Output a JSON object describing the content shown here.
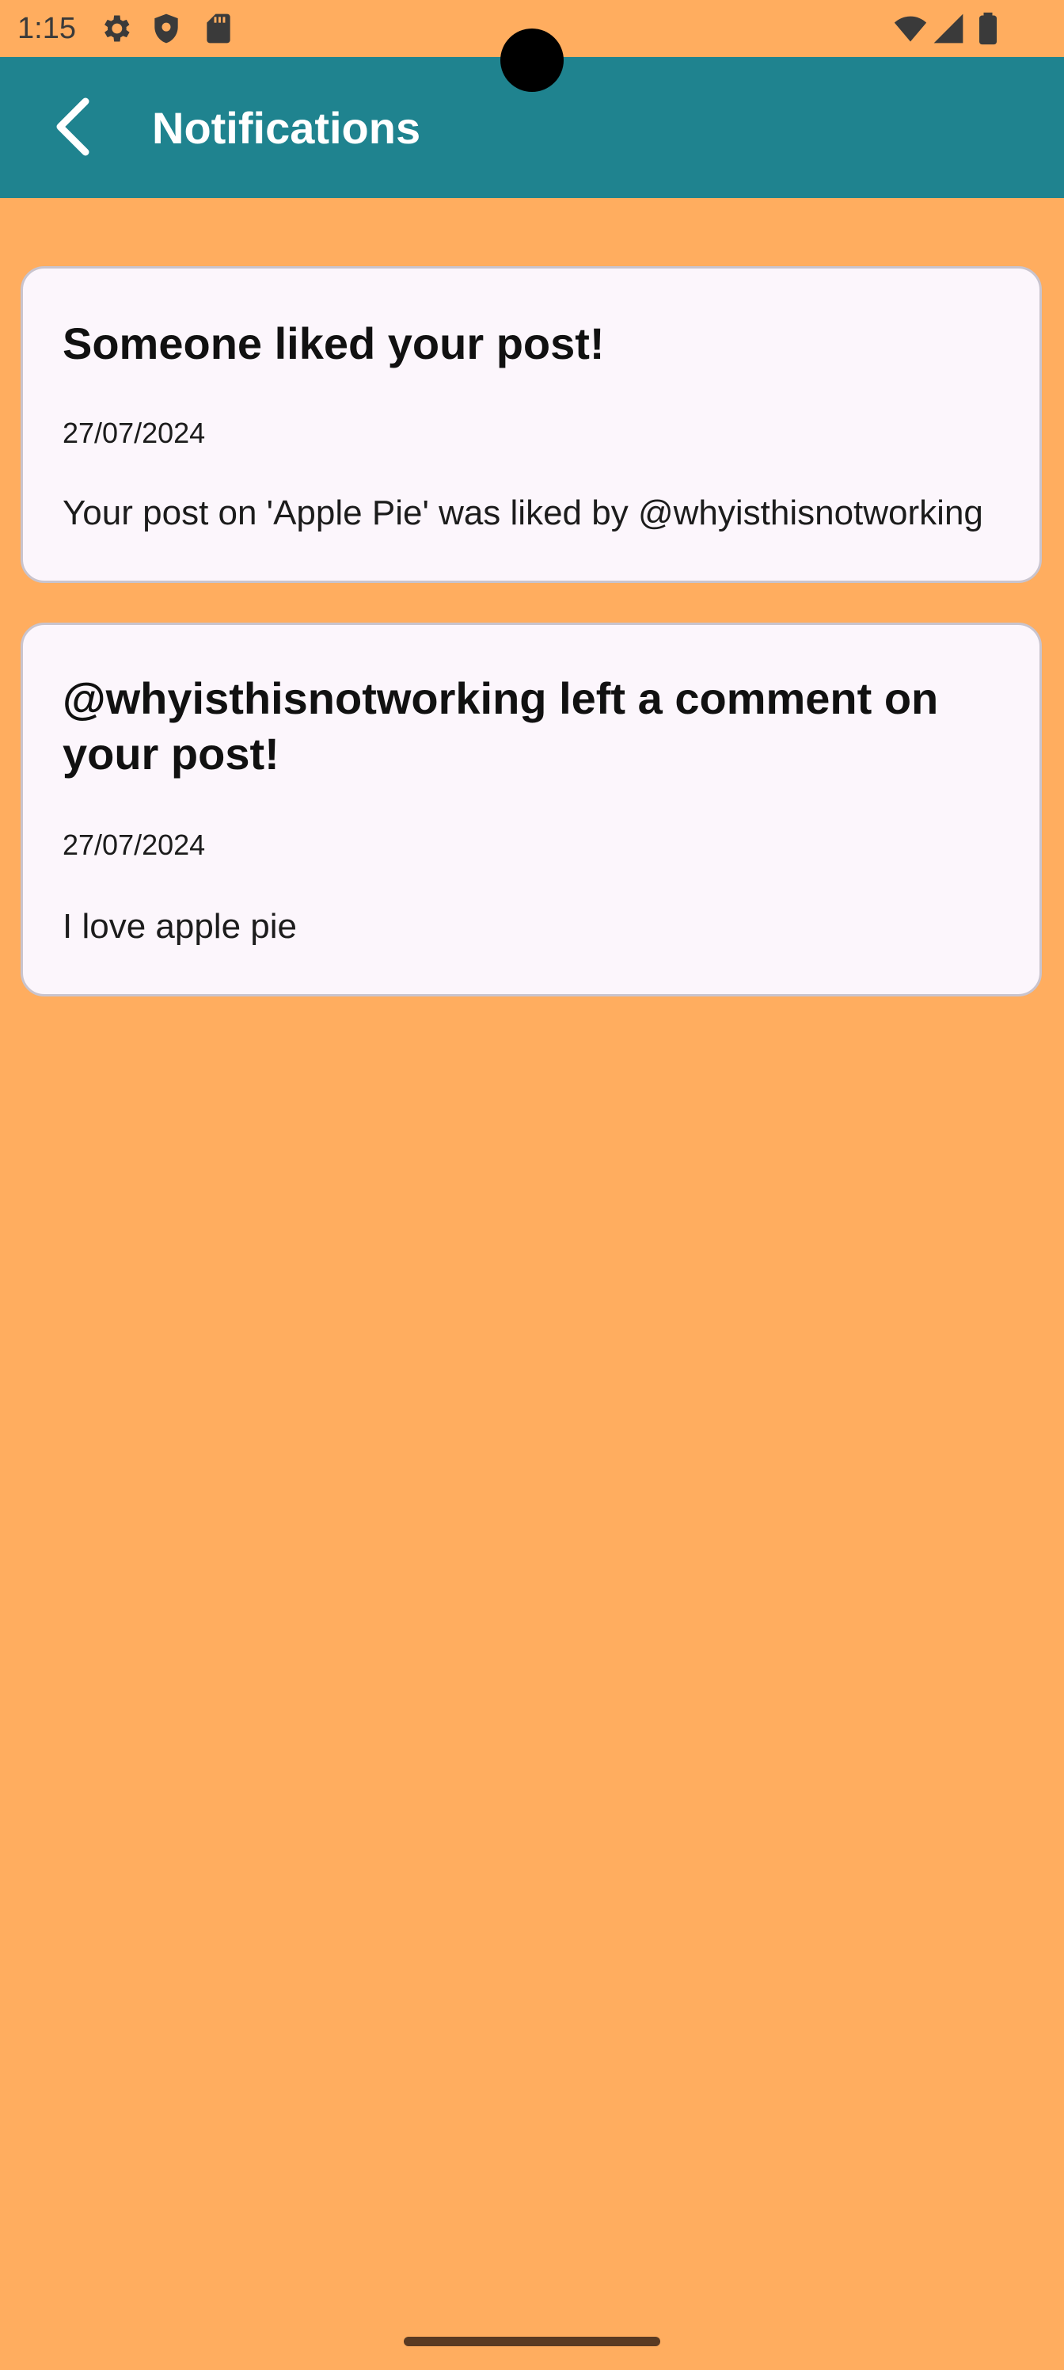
{
  "status_bar": {
    "time": "1:15",
    "icons_left": [
      "gear-icon",
      "shield-icon",
      "sd-card-icon"
    ],
    "icons_right": [
      "wifi-icon",
      "signal-icon",
      "battery-icon"
    ]
  },
  "toolbar": {
    "title": "Notifications",
    "back_icon": "chevron-left-icon"
  },
  "notifications": [
    {
      "title": "Someone liked your post!",
      "date": "27/07/2024",
      "body": "Your post on 'Apple Pie' was liked by @whyisthisnotworking"
    },
    {
      "title": "@whyisthisnotworking left a comment on your post!",
      "date": "27/07/2024",
      "body": "I love apple pie"
    }
  ],
  "colors": {
    "background": "#FFAD5F",
    "toolbar": "#1F838F",
    "card": "#FCF6FC",
    "card_border": "#C9C4CE"
  }
}
